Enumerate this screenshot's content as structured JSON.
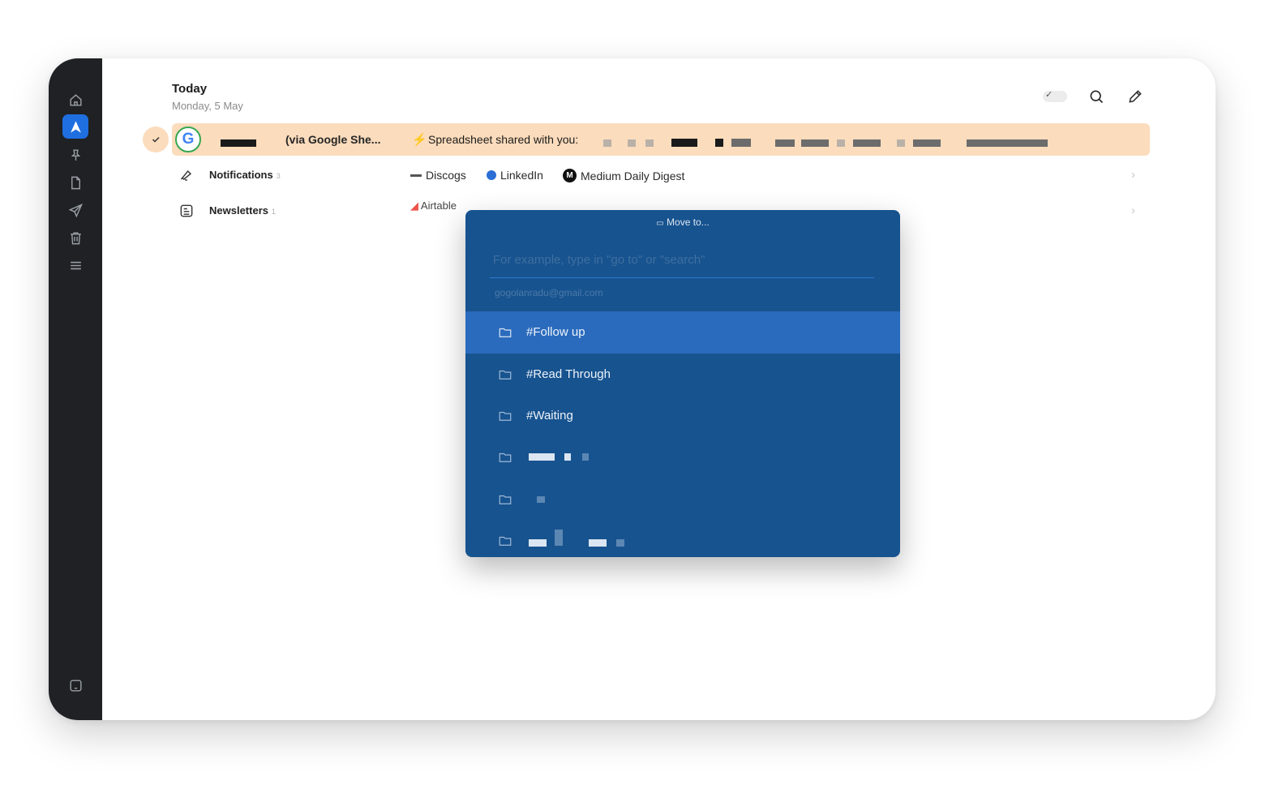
{
  "colors": {
    "sidebar_bg": "#1f2124",
    "accent": "#1f6fe0",
    "highlight_row": "#fbdcbc",
    "modal_bg": "#17538f",
    "modal_selected": "#2a6bbd"
  },
  "sidebar": {
    "items": [
      {
        "icon": "home-icon"
      },
      {
        "icon": "app-logo-icon",
        "active": true
      },
      {
        "icon": "pin-icon"
      },
      {
        "icon": "document-icon"
      },
      {
        "icon": "send-icon"
      },
      {
        "icon": "trash-icon"
      },
      {
        "icon": "menu-icon"
      }
    ],
    "bottom_icon": "keyboard-icon"
  },
  "header": {
    "title": "Today",
    "subtitle": "Monday, 5 May",
    "icons": [
      "toggle-icon",
      "search-icon",
      "compose-icon"
    ]
  },
  "email": {
    "sender_suffix": "(via Google She...",
    "subject": "Spreadsheet shared with you:",
    "avatar_letter": "G"
  },
  "categories": [
    {
      "label": "Notifications",
      "count": "3",
      "sources": [
        {
          "name": "Discogs",
          "icon": "discogs-icon"
        },
        {
          "name": "LinkedIn",
          "icon": "linkedin-icon"
        },
        {
          "name": "Medium Daily Digest",
          "icon": "medium-icon",
          "badge": "M"
        }
      ]
    },
    {
      "label": "Newsletters",
      "count": "1",
      "sources": [
        {
          "name": "Airtable",
          "icon": "airtable-icon"
        }
      ]
    }
  ],
  "modal": {
    "title": "Move to...",
    "placeholder": "For example, type in \"go to\" or \"search\"",
    "account": "gogolanradu@gmail.com",
    "folders": [
      {
        "label": "#Follow up",
        "selected": true
      },
      {
        "label": "#Read Through"
      },
      {
        "label": "#Waiting"
      },
      {
        "label": ""
      },
      {
        "label": ""
      },
      {
        "label": ""
      }
    ]
  }
}
